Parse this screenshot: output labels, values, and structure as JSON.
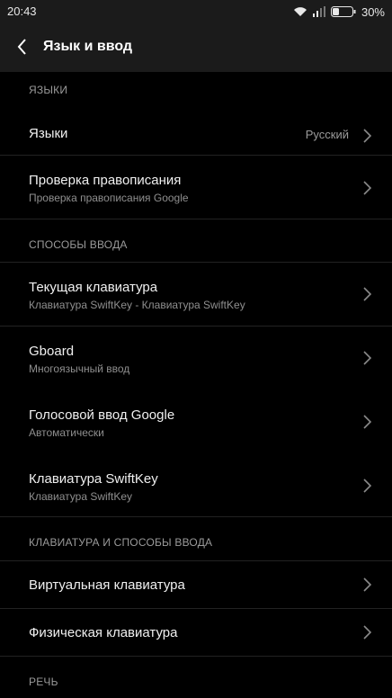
{
  "status": {
    "time": "20:43",
    "battery": "30%"
  },
  "appbar": {
    "title": "Язык и ввод"
  },
  "sections": {
    "languages_header": "ЯЗЫКИ",
    "input_header": "СПОСОБЫ ВВОДА",
    "keyboards_header": "КЛАВИАТУРА И СПОСОБЫ ВВОДА",
    "speech_header": "РЕЧЬ"
  },
  "rows": {
    "languages": {
      "title": "Языки",
      "value": "Русский"
    },
    "spellcheck": {
      "title": "Проверка правописания",
      "subtitle": "Проверка правописания Google"
    },
    "current_keyboard": {
      "title": "Текущая клавиатура",
      "subtitle": "Клавиатура SwiftKey - Клавиатура SwiftKey"
    },
    "gboard": {
      "title": "Gboard",
      "subtitle": "Многоязычный ввод"
    },
    "google_voice": {
      "title": "Голосовой ввод Google",
      "subtitle": "Автоматически"
    },
    "swiftkey": {
      "title": "Клавиатура SwiftKey",
      "subtitle": "Клавиатура SwiftKey"
    },
    "virtual_keyboard": {
      "title": "Виртуальная клавиатура"
    },
    "physical_keyboard": {
      "title": "Физическая клавиатура"
    }
  }
}
